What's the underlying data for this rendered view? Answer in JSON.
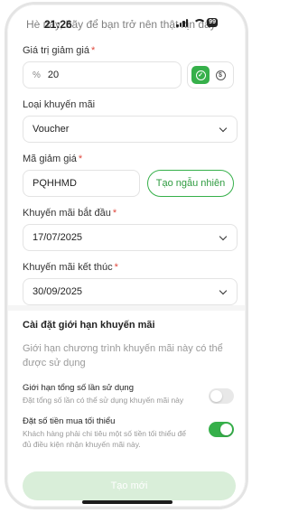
{
  "status": {
    "time": "21:26",
    "battery": "99"
  },
  "header": {
    "text": "Hè này, hãy để bạn trở nên thật xịn đấy"
  },
  "form": {
    "discount_value": {
      "label": "Giá trị giảm giá",
      "required_mark": "*",
      "prefix": "%",
      "value": "20"
    },
    "promo_type": {
      "label": "Loại khuyến mãi",
      "value": "Voucher"
    },
    "code": {
      "label": "Mã giảm giá",
      "required_mark": "*",
      "value": "PQHHMD",
      "generate_label": "Tạo ngẫu nhiên"
    },
    "start_date": {
      "label": "Khuyến mãi bắt đầu",
      "required_mark": "*",
      "value": "17/07/2025"
    },
    "end_date": {
      "label": "Khuyến mãi kết thúc",
      "required_mark": "*",
      "value": "30/09/2025"
    }
  },
  "limits": {
    "title": "Cài đặt giới hạn khuyến mãi",
    "description": "Giới hạn chương trình khuyến mãi này có thể được sử dụng",
    "options": [
      {
        "title": "Giới hạn tổng số lần sử dụng",
        "description": "Đặt tổng số lần có thể sử dụng khuyến mãi này",
        "enabled": false
      },
      {
        "title": "Đặt số tiền mua tối thiểu",
        "description": "Khách hàng phải chi tiêu một số tiền tối thiểu để đủ điều kiện nhận khuyến mãi này.",
        "enabled": true
      }
    ]
  },
  "actions": {
    "create_label": "Tạo mới"
  },
  "colors": {
    "accent": "#36b04a",
    "required": "#e0483d",
    "button_disabled": "#d9eed9"
  }
}
